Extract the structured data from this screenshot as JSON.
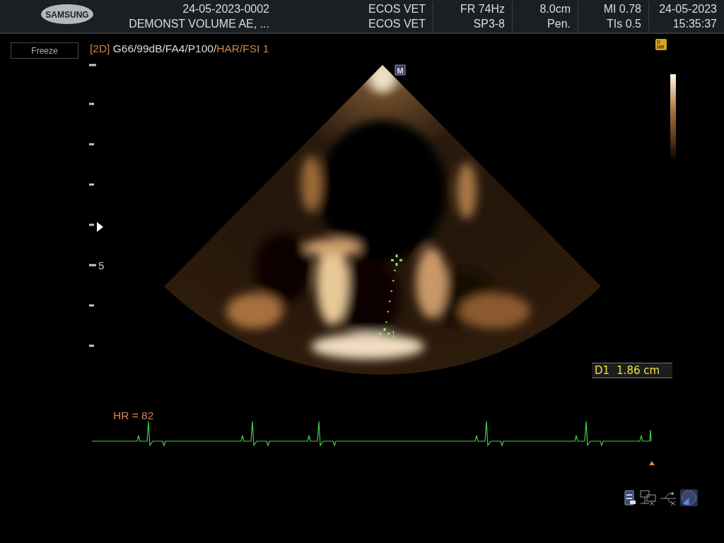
{
  "header": {
    "logo": "SAMSUNG",
    "patient_id": "24-05-2023-0002",
    "patient_name": "DEMONST VOLUME AE, ...",
    "columns": [
      {
        "line_1": "ECOS VET",
        "line_2": "ECOS VET"
      },
      {
        "line_1": "FR 74Hz",
        "line_2": "SP3-8"
      },
      {
        "line_1": "8.0cm",
        "line_2": "Pen."
      },
      {
        "line_1": "MI 0.78",
        "line_2": "TIs 0.5"
      },
      {
        "line_1": "24-05-2023",
        "line_2": "15:35:37"
      }
    ]
  },
  "freeze_button": "Freeze",
  "imaging_params": [
    {
      "text": "[2D]",
      "color": "#c8874a"
    },
    {
      "text": " G66/99dB/FA4/P100/",
      "color": "#dcdcdc"
    },
    {
      "text": "HAR/FSI 1",
      "color": "#c8874a"
    }
  ],
  "badge": {
    "line_1": "D",
    "line_2": "MR"
  },
  "probe_marker": "M",
  "depth_scale": {
    "label": "5"
  },
  "measurement": {
    "caliper_label": "1",
    "name": "D1",
    "value": "1.86 cm"
  },
  "ecg": {
    "heart_rate": "HR = 82"
  }
}
